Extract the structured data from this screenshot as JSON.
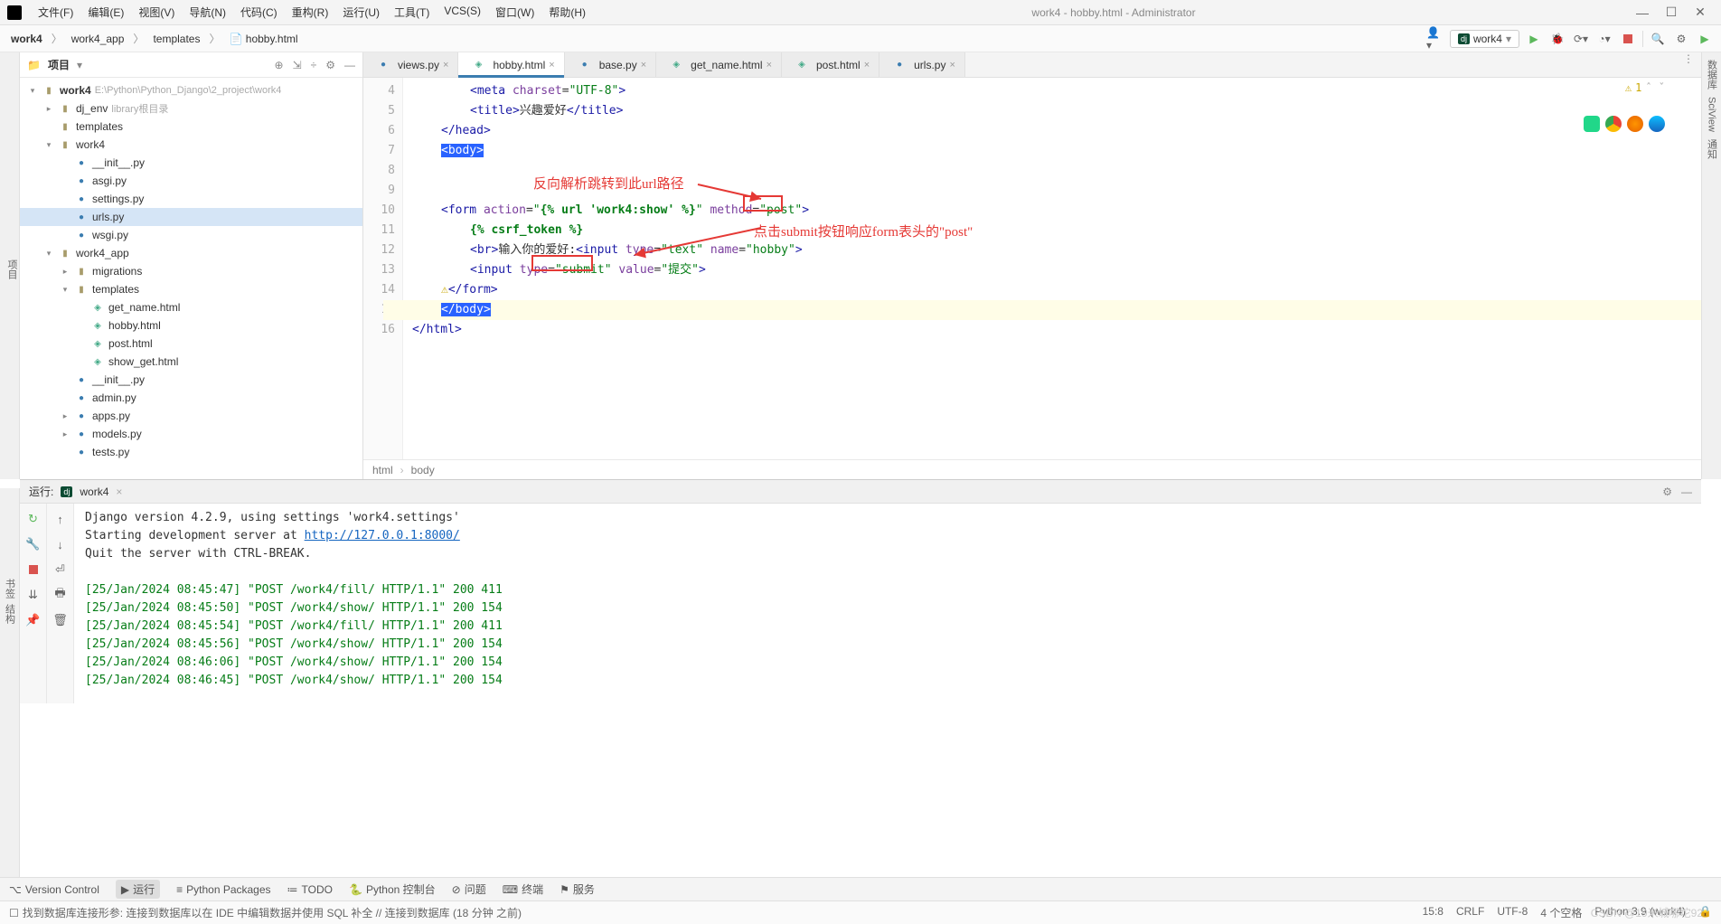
{
  "title": "work4 - hobby.html - Administrator",
  "menu": [
    "文件(F)",
    "编辑(E)",
    "视图(V)",
    "导航(N)",
    "代码(C)",
    "重构(R)",
    "运行(U)",
    "工具(T)",
    "VCS(S)",
    "窗口(W)",
    "帮助(H)"
  ],
  "breadcrumbs": [
    "work4",
    "work4_app",
    "templates",
    "hobby.html"
  ],
  "run_config": "work4",
  "project": {
    "label": "项目",
    "root": {
      "name": "work4",
      "path": "E:\\Python\\Python_Django\\2_project\\work4"
    },
    "tree": [
      {
        "depth": 0,
        "exp": "v",
        "icon": "dir",
        "label": "work4",
        "hint": "E:\\Python\\Python_Django\\2_project\\work4",
        "bold": true
      },
      {
        "depth": 1,
        "exp": ">",
        "icon": "dir",
        "label": "dj_env",
        "hint": "library根目录"
      },
      {
        "depth": 1,
        "exp": "",
        "icon": "dir",
        "label": "templates"
      },
      {
        "depth": 1,
        "exp": "v",
        "icon": "dir",
        "label": "work4"
      },
      {
        "depth": 2,
        "exp": "",
        "icon": "py",
        "label": "__init__.py"
      },
      {
        "depth": 2,
        "exp": "",
        "icon": "py",
        "label": "asgi.py"
      },
      {
        "depth": 2,
        "exp": "",
        "icon": "py",
        "label": "settings.py"
      },
      {
        "depth": 2,
        "exp": "",
        "icon": "py",
        "label": "urls.py",
        "selected": true
      },
      {
        "depth": 2,
        "exp": "",
        "icon": "py",
        "label": "wsgi.py"
      },
      {
        "depth": 1,
        "exp": "v",
        "icon": "dir",
        "label": "work4_app"
      },
      {
        "depth": 2,
        "exp": ">",
        "icon": "dir",
        "label": "migrations"
      },
      {
        "depth": 2,
        "exp": "v",
        "icon": "dir",
        "label": "templates"
      },
      {
        "depth": 3,
        "exp": "",
        "icon": "html",
        "label": "get_name.html"
      },
      {
        "depth": 3,
        "exp": "",
        "icon": "html",
        "label": "hobby.html"
      },
      {
        "depth": 3,
        "exp": "",
        "icon": "html",
        "label": "post.html"
      },
      {
        "depth": 3,
        "exp": "",
        "icon": "html",
        "label": "show_get.html"
      },
      {
        "depth": 2,
        "exp": "",
        "icon": "py",
        "label": "__init__.py"
      },
      {
        "depth": 2,
        "exp": "",
        "icon": "py",
        "label": "admin.py"
      },
      {
        "depth": 2,
        "exp": ">",
        "icon": "py",
        "label": "apps.py"
      },
      {
        "depth": 2,
        "exp": ">",
        "icon": "py",
        "label": "models.py"
      },
      {
        "depth": 2,
        "exp": "",
        "icon": "py",
        "label": "tests.py"
      }
    ]
  },
  "tabs": [
    {
      "icon": "py",
      "label": "views.py"
    },
    {
      "icon": "html",
      "label": "hobby.html",
      "active": true
    },
    {
      "icon": "py",
      "label": "base.py"
    },
    {
      "icon": "html",
      "label": "get_name.html"
    },
    {
      "icon": "html",
      "label": "post.html"
    },
    {
      "icon": "py",
      "label": "urls.py"
    }
  ],
  "gutter": [
    "4",
    "5",
    "6",
    "7",
    "8",
    "9",
    "10",
    "11",
    "12",
    "13",
    "14",
    "15",
    "16"
  ],
  "code": {
    "l4": "        <meta charset=\"UTF-8\">",
    "l5": "        <title>兴趣爱好</title>",
    "l6": "    </head>",
    "l7": "    <body>",
    "l8": "",
    "l9": "",
    "l10": "    <form action=\"{% url 'work4:show' %}\" method=\"post\">",
    "l11": "        {% csrf_token %}",
    "l12": "        <br>输入你的爱好:<input type=\"text\" name=\"hobby\">",
    "l13": "        <input type=\"submit\" value=\"提交\">",
    "l14": "    </form>",
    "l15": "    </body>",
    "l16": "</html>"
  },
  "annotations": {
    "a1": "反向解析跳转到此url路径",
    "a2": "点击submit按钮响应form表头的\"post\""
  },
  "warn_count": "1",
  "crumb_bar": [
    "html",
    "body"
  ],
  "run": {
    "label": "运行:",
    "tab": "work4",
    "lines": [
      {
        "type": "plain",
        "text": "Django version 4.2.9, using settings 'work4.settings'"
      },
      {
        "type": "link",
        "prefix": "Starting development server at ",
        "url": "http://127.0.0.1:8000/"
      },
      {
        "type": "plain",
        "text": "Quit the server with CTRL-BREAK."
      },
      {
        "type": "blank"
      },
      {
        "type": "req",
        "text": "[25/Jan/2024 08:45:47] \"POST /work4/fill/ HTTP/1.1\" 200 411"
      },
      {
        "type": "req",
        "text": "[25/Jan/2024 08:45:50] \"POST /work4/show/ HTTP/1.1\" 200 154"
      },
      {
        "type": "req",
        "text": "[25/Jan/2024 08:45:54] \"POST /work4/fill/ HTTP/1.1\" 200 411"
      },
      {
        "type": "req",
        "text": "[25/Jan/2024 08:45:56] \"POST /work4/show/ HTTP/1.1\" 200 154"
      },
      {
        "type": "req",
        "text": "[25/Jan/2024 08:46:06] \"POST /work4/show/ HTTP/1.1\" 200 154"
      },
      {
        "type": "req",
        "text": "[25/Jan/2024 08:46:45] \"POST /work4/show/ HTTP/1.1\" 200 154"
      }
    ]
  },
  "bottom_items": [
    "Version Control",
    "运行",
    "Python Packages",
    "TODO",
    "Python 控制台",
    "问题",
    "终端",
    "服务"
  ],
  "status": {
    "msg": "找到数据库连接形参: 连接到数据库以在 IDE 中编辑数据并使用 SQL 补全 // 连接到数据库 (18 分钟 之前)",
    "right": [
      "15:8",
      "CRLF",
      "UTF-8",
      "4 个空格",
      "Python 3.9 (work4)"
    ]
  },
  "left_strip": "项目",
  "right_strip_items": [
    "数据库",
    "SciView",
    "通知"
  ],
  "watermark": "CSDN @19米城哪坨92"
}
